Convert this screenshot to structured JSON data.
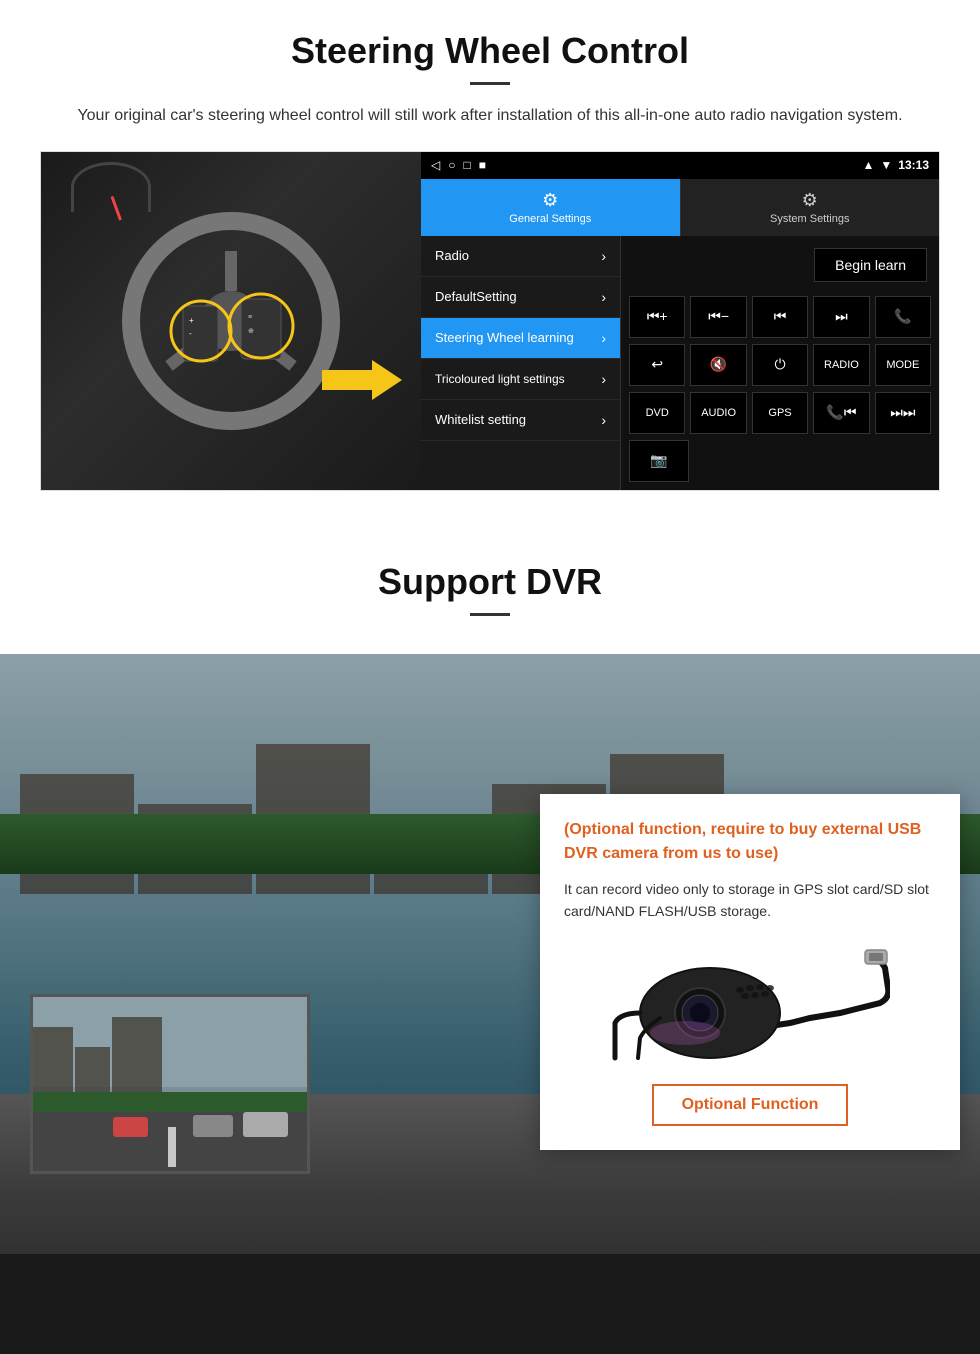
{
  "page": {
    "section1": {
      "title": "Steering Wheel Control",
      "description": "Your original car's steering wheel control will still work after installation of this all-in-one auto radio navigation system.",
      "ui": {
        "statusbar": {
          "time": "13:13",
          "icons": [
            "◁",
            "○",
            "□",
            "■",
            "♥",
            "▼"
          ]
        },
        "tabs": [
          {
            "label": "General Settings",
            "icon": "⚙",
            "active": true
          },
          {
            "label": "System Settings",
            "icon": "⚙",
            "active": false
          }
        ],
        "menu_items": [
          {
            "label": "Radio",
            "active": false
          },
          {
            "label": "DefaultSetting",
            "active": false
          },
          {
            "label": "Steering Wheel learning",
            "active": true
          },
          {
            "label": "Tricoloured light settings",
            "active": false
          },
          {
            "label": "Whitelist setting",
            "active": false
          }
        ],
        "begin_learn": "Begin learn",
        "controls": [
          [
            "⏮+",
            "⏮-",
            "⏮⏮",
            "⏭⏭",
            "📞"
          ],
          [
            "↩",
            "🔇x",
            "⏻",
            "RADIO",
            "MODE"
          ],
          [
            "DVD",
            "AUDIO",
            "GPS",
            "📞⏮",
            "⏭⏭"
          ],
          [
            "📷"
          ]
        ]
      }
    },
    "section2": {
      "title": "Support DVR",
      "card": {
        "optional_heading": "(Optional function, require to buy external USB DVR camera from us to use)",
        "description": "It can record video only to storage in GPS slot card/SD slot card/NAND FLASH/USB storage.",
        "optional_button": "Optional Function"
      }
    }
  }
}
